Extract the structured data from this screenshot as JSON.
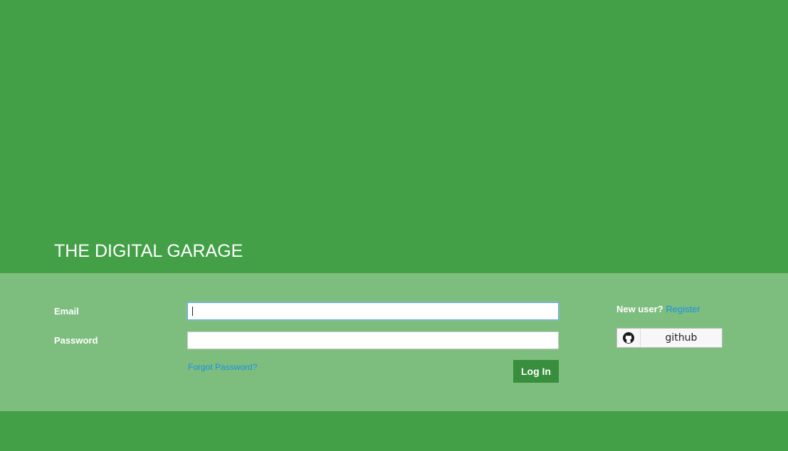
{
  "header": {
    "site_title": "THE DIGITAL GARAGE"
  },
  "login_form": {
    "email_label": "Email",
    "email_value": "",
    "password_label": "Password",
    "password_value": "",
    "forgot_password_label": "Forgot Password?",
    "login_button_label": "Log In"
  },
  "register": {
    "new_user_text": "New user?",
    "register_link_label": "Register"
  },
  "oauth": {
    "github_label": "github",
    "github_icon": "github-icon"
  },
  "colors": {
    "background": "#43a047",
    "band": "#7dbe7f",
    "button": "#388e3c",
    "link": "#1e8fe0"
  }
}
